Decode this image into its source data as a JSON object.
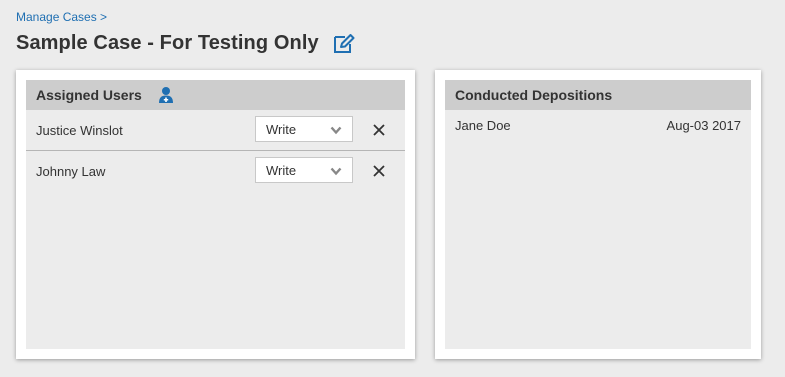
{
  "breadcrumb": "Manage Cases >",
  "page_title": "Sample Case - For Testing Only",
  "assigned_users": {
    "title": "Assigned Users",
    "users": [
      {
        "name": "Justice Winslot",
        "permission": "Write"
      },
      {
        "name": "Johnny Law",
        "permission": "Write"
      }
    ]
  },
  "depositions": {
    "title": "Conducted Depositions",
    "items": [
      {
        "name": "Jane Doe",
        "date": "Aug-03 2017"
      }
    ]
  },
  "colors": {
    "accent": "#1f6fb2",
    "header_bg": "#cdcdcd",
    "panel_bg": "#ececec"
  },
  "icons": {
    "edit": "edit-icon",
    "add_user": "add-user-icon",
    "remove": "close-icon",
    "dropdown": "chevron-down-icon"
  }
}
